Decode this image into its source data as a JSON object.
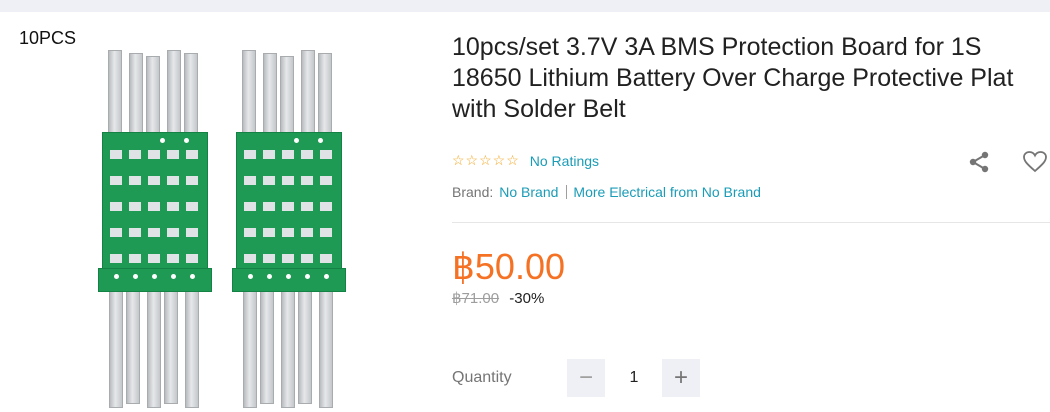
{
  "product": {
    "image_label": "10PCS",
    "title": "10pcs/set 3.7V 3A BMS Protection Board for 1S 18650 Lithium Battery Over Charge Protective Plat with Solder Belt",
    "rating_stars": "☆☆☆☆☆",
    "ratings_text": "No Ratings",
    "brand_label": "Brand:",
    "brand_name": "No Brand",
    "more_from": "More Electrical from No Brand",
    "price": "฿50.00",
    "original_price": "฿71.00",
    "discount": "-30%"
  },
  "quantity": {
    "label": "Quantity",
    "value": "1",
    "minus": "−",
    "plus": "+"
  },
  "icons": {
    "share": "share-icon",
    "wishlist": "heart-icon"
  },
  "colors": {
    "price": "#f57224",
    "link": "#1a9cb7",
    "pcb": "#1f9a54"
  }
}
